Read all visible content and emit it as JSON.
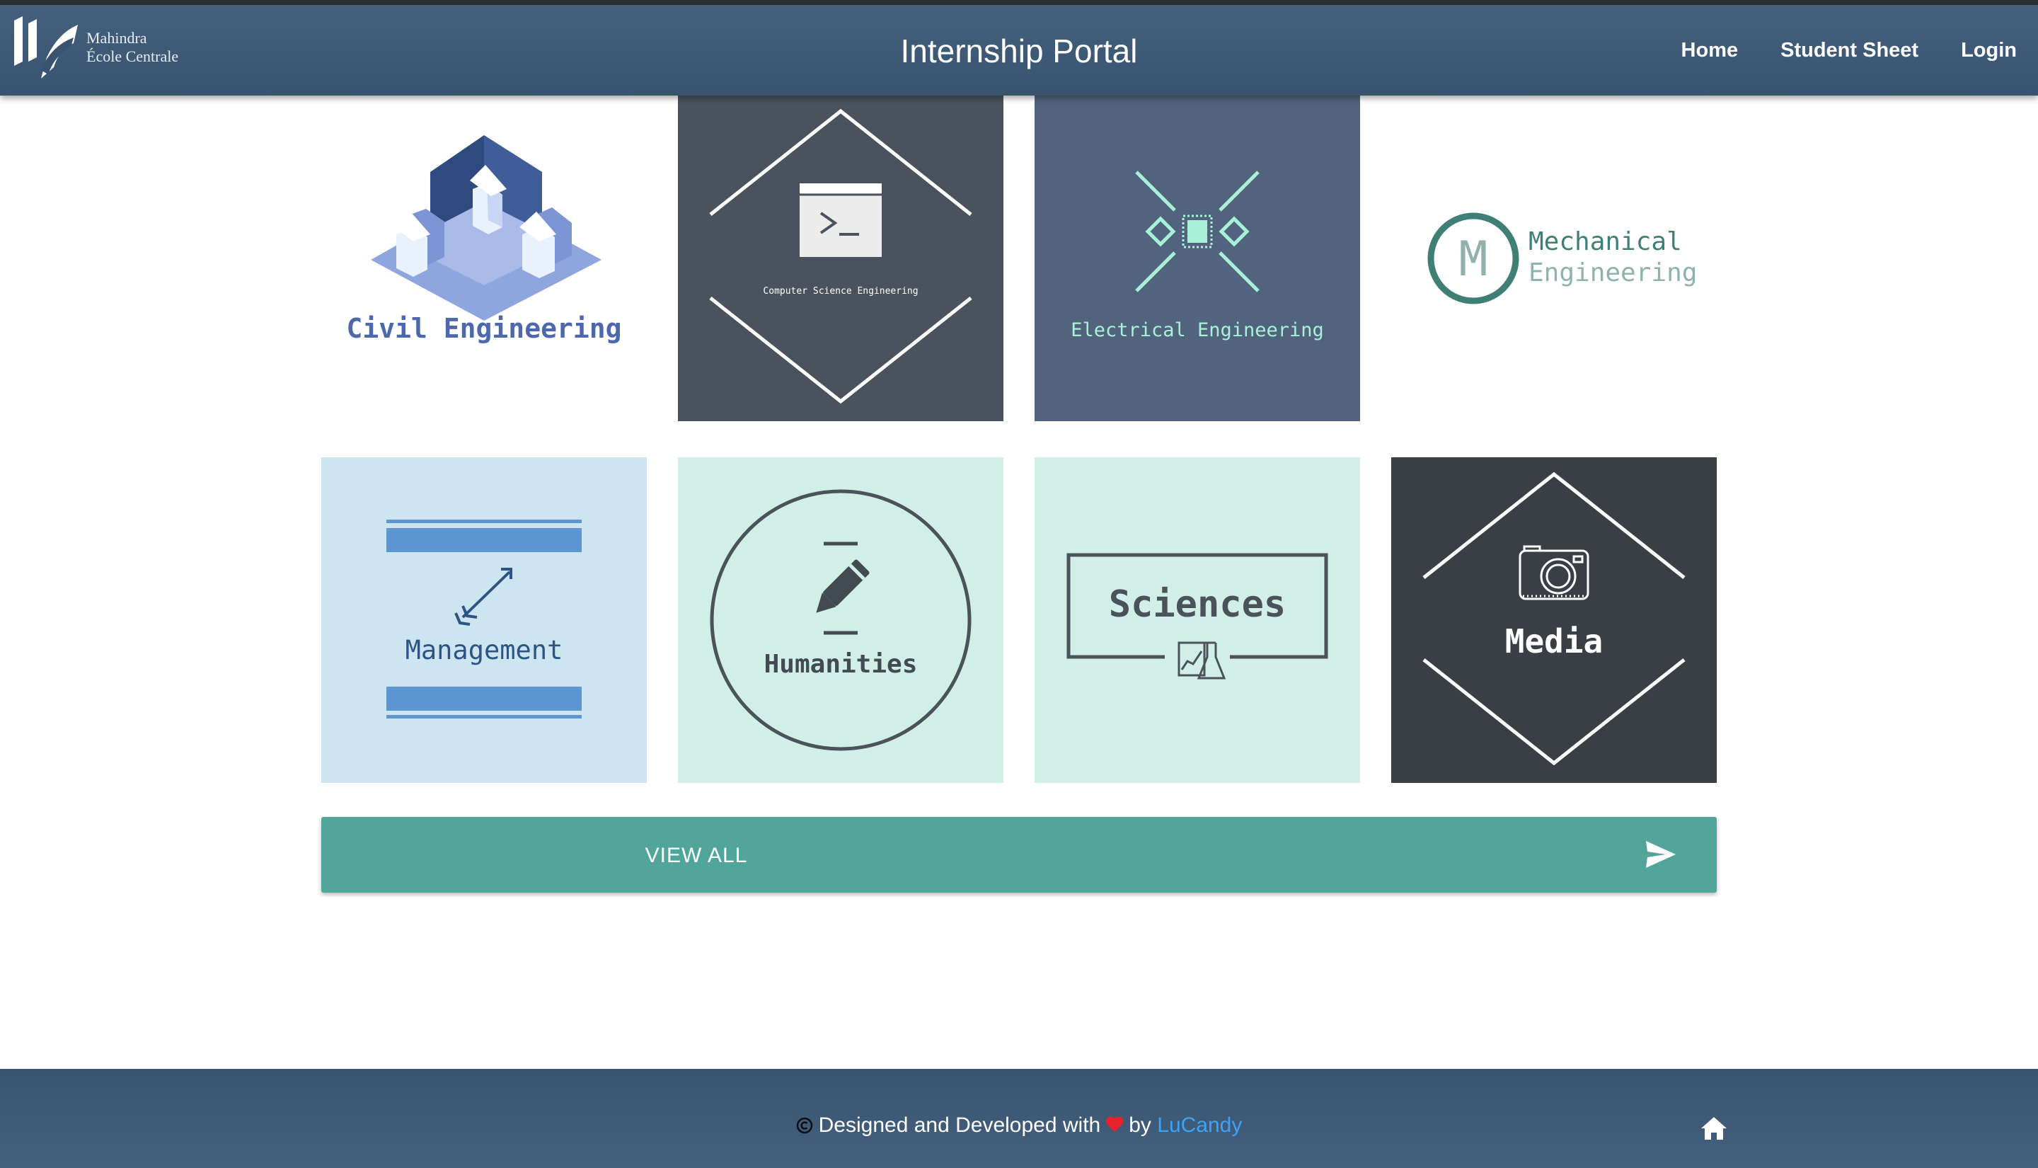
{
  "header": {
    "logo_lines": [
      "Mahindra",
      "École Centrale"
    ],
    "title": "Internship Portal",
    "nav": [
      {
        "label": "Home"
      },
      {
        "label": "Student Sheet"
      },
      {
        "label": "Login"
      }
    ]
  },
  "tiles": [
    {
      "label": "Civil Engineering",
      "icon": "isometric-buildings-icon",
      "bg": "#ffffff",
      "fg": "#4d68ad"
    },
    {
      "label": "Computer Science Engineering",
      "icon": "terminal-icon",
      "bg": "#4a535d",
      "fg": "#ffffff"
    },
    {
      "label": "Electrical Engineering",
      "icon": "chip-icon",
      "bg": "#52647d",
      "fg": "#a8f0d8"
    },
    {
      "label_lines": [
        "Mechanical",
        "Engineering"
      ],
      "monogram": "M",
      "icon": "monogram-badge-icon",
      "bg": "#ffffff",
      "fg": "#3f7f76"
    },
    {
      "label": "Management",
      "icon": "arrow-icon",
      "bg": "#cde4f1",
      "fg": "#2c5484"
    },
    {
      "label": "Humanities",
      "icon": "pen-icon",
      "bg": "#d1efe6",
      "fg": "#424a52"
    },
    {
      "label": "Sciences",
      "icon": "flask-icon",
      "bg": "#d1efe6",
      "fg": "#4a525a"
    },
    {
      "label": "Media",
      "icon": "camera-icon",
      "bg": "#3a3e45",
      "fg": "#ffffff"
    }
  ],
  "view_all": {
    "label": "VIEW ALL",
    "icon": "send-icon"
  },
  "footer": {
    "prefix": "Designed and Developed with",
    "middle": "by",
    "link": "LuCandy",
    "icons": [
      "copyright-icon",
      "heart-icon",
      "home-icon"
    ]
  },
  "colors": {
    "header_bg": "#3d5875",
    "accent_teal": "#52a59b",
    "link_blue": "#3ea3f4",
    "heart_red": "#e8212d"
  }
}
